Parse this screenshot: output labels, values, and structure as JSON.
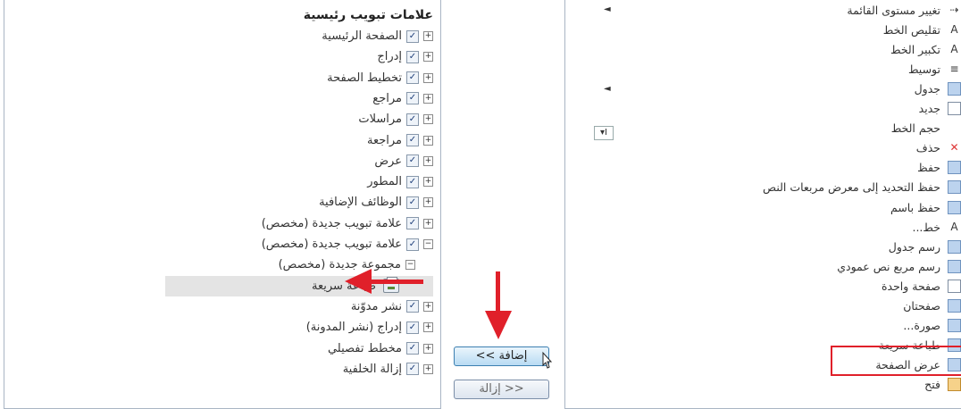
{
  "left_tree": {
    "header": "علامات تبويب رئيسية",
    "items": [
      {
        "label": "الصفحة الرئيسية",
        "expander": "+",
        "checked": true
      },
      {
        "label": "إدراج",
        "expander": "+",
        "checked": true
      },
      {
        "label": "تخطيط الصفحة",
        "expander": "+",
        "checked": true
      },
      {
        "label": "مراجع",
        "expander": "+",
        "checked": true
      },
      {
        "label": "مراسلات",
        "expander": "+",
        "checked": true
      },
      {
        "label": "مراجعة",
        "expander": "+",
        "checked": true
      },
      {
        "label": "عرض",
        "expander": "+",
        "checked": true
      },
      {
        "label": "المطور",
        "expander": "+",
        "checked": true
      },
      {
        "label": "الوظائف الإضافية",
        "expander": "+",
        "checked": true
      },
      {
        "label": "علامة تبويب جديدة (مخصص)",
        "expander": "+",
        "checked": true
      },
      {
        "label": "علامة تبويب جديدة (مخصص)",
        "expander": "−",
        "checked": true
      },
      {
        "label": "مجموعة جديدة (مخصص)",
        "expander": "−"
      },
      {
        "label": "طباعة سريعة"
      },
      {
        "label": "نشر مدوّنة",
        "expander": "+",
        "checked": true
      },
      {
        "label": "إدراج (نشر المدونة)",
        "expander": "+",
        "checked": true
      },
      {
        "label": "مخطط تفصيلي",
        "expander": "+",
        "checked": true
      },
      {
        "label": "إزالة الخلفية",
        "expander": "+",
        "checked": true
      }
    ]
  },
  "buttons": {
    "add": "إضافة >>",
    "remove": "<< إزالة"
  },
  "right_list": {
    "items": [
      {
        "label": "تغيير مستوى القائمة",
        "icon": "list-level-icon",
        "glyph": "⇢"
      },
      {
        "label": "تقليص الخط",
        "icon": "shrink-font-icon",
        "glyph": "A"
      },
      {
        "label": "تكبير الخط",
        "icon": "grow-font-icon",
        "glyph": "A"
      },
      {
        "label": "توسيط",
        "icon": "center-align-icon",
        "glyph": "≡"
      },
      {
        "label": "جدول",
        "icon": "table-icon",
        "glyph": ""
      },
      {
        "label": "جديد",
        "icon": "new-document-icon",
        "glyph": ""
      },
      {
        "label": "حجم الخط",
        "icon": "none",
        "glyph": ""
      },
      {
        "label": "حذف",
        "icon": "delete-icon",
        "glyph": "✕"
      },
      {
        "label": "حفظ",
        "icon": "save-icon",
        "glyph": ""
      },
      {
        "label": "حفظ التحديد إلى معرض مربعات النص",
        "icon": "save-selection-icon",
        "glyph": ""
      },
      {
        "label": "حفظ باسم",
        "icon": "save-as-icon",
        "glyph": ""
      },
      {
        "label": "خط...",
        "icon": "font-icon",
        "glyph": "A"
      },
      {
        "label": "رسم جدول",
        "icon": "draw-table-icon",
        "glyph": ""
      },
      {
        "label": "رسم مربع نص عمودي",
        "icon": "vertical-text-box-icon",
        "glyph": ""
      },
      {
        "label": "صفحة واحدة",
        "icon": "one-page-icon",
        "glyph": ""
      },
      {
        "label": "صفحتان",
        "icon": "two-pages-icon",
        "glyph": ""
      },
      {
        "label": "صورة...",
        "icon": "picture-icon",
        "glyph": ""
      },
      {
        "label": "طباعة سريعة",
        "icon": "quick-print-icon",
        "glyph": ""
      },
      {
        "label": "عرض الصفحة",
        "icon": "page-width-icon",
        "glyph": ""
      },
      {
        "label": "فتح",
        "icon": "open-folder-icon",
        "glyph": ""
      }
    ],
    "size_control_glyph": "▾I"
  }
}
